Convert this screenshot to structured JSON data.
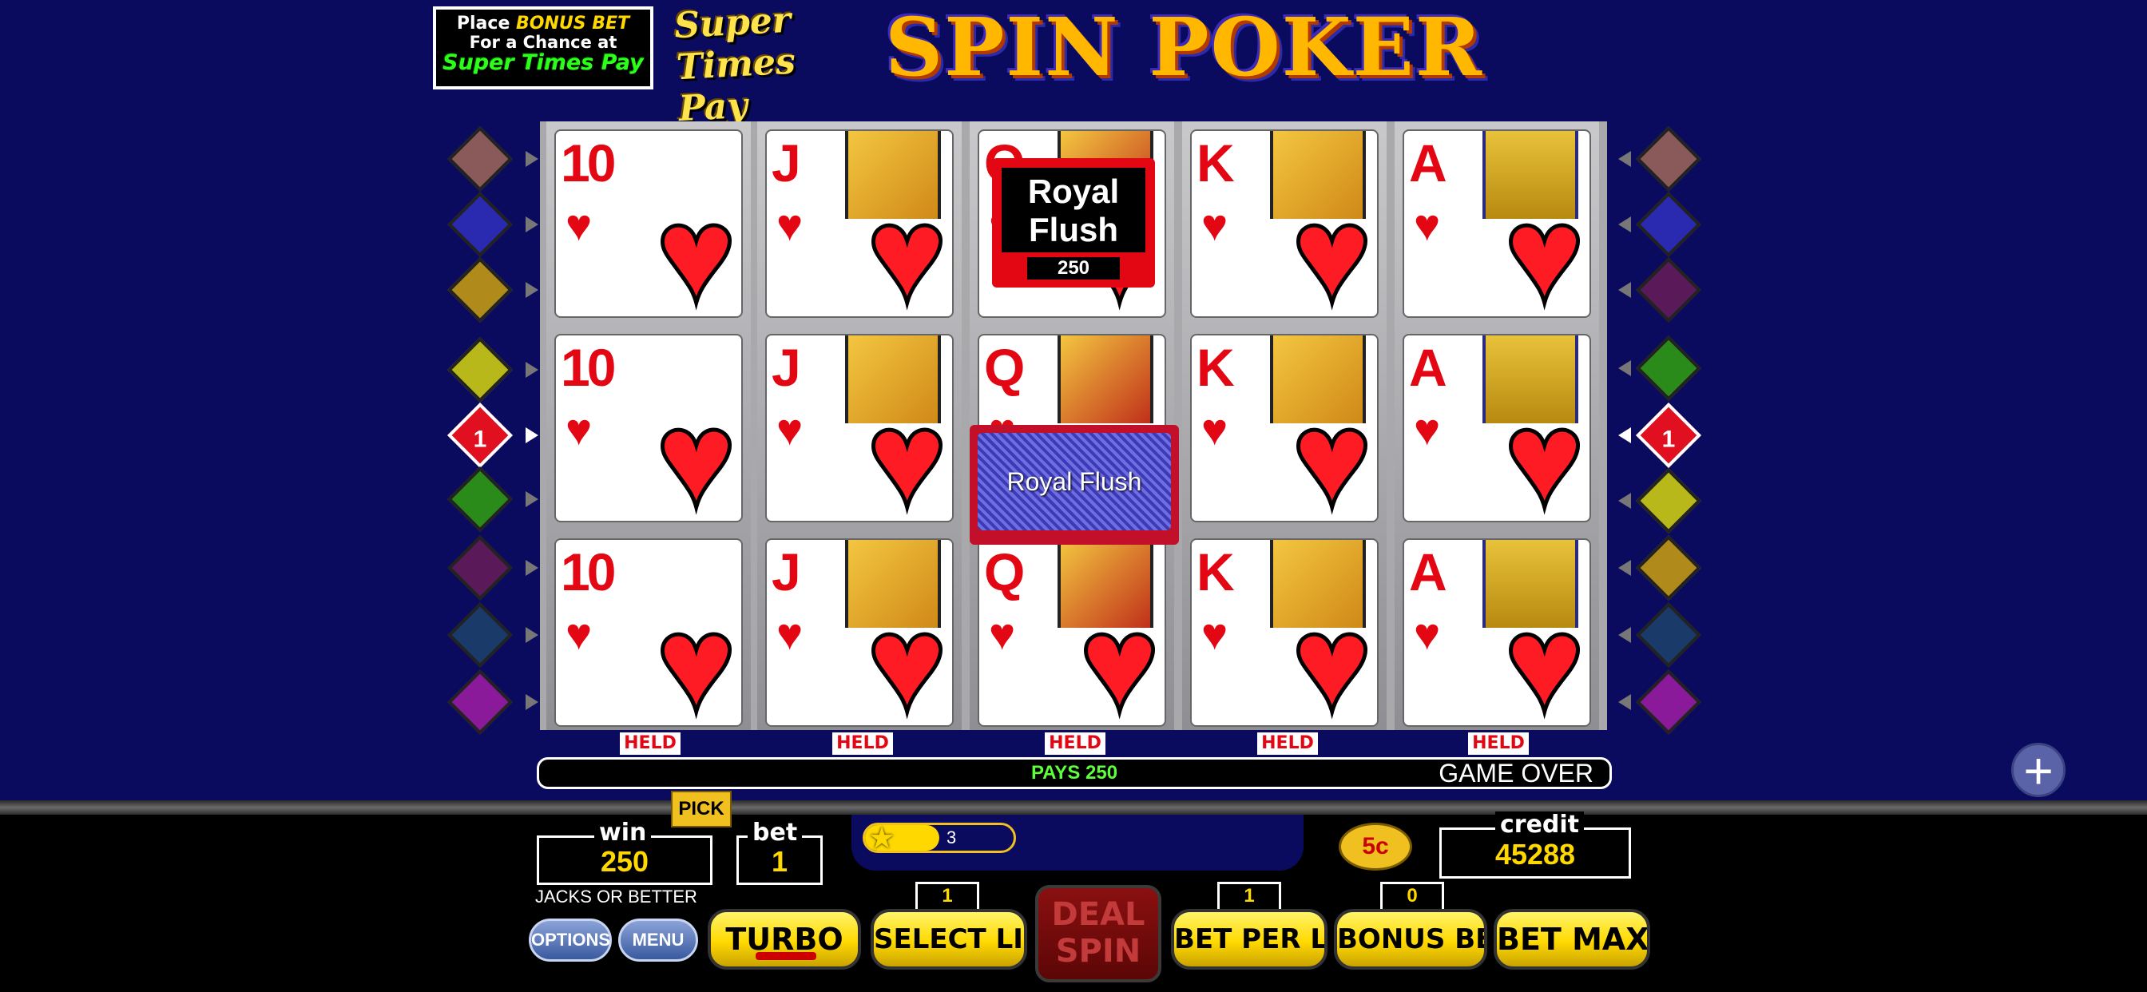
{
  "banner": {
    "promo_line1_a": "Place ",
    "promo_line1_b": "BONUS BET",
    "promo_line2": "For a Chance at",
    "promo_line3": "Super Times Pay",
    "stp_line1": "Super",
    "stp_line2": "Times Pay",
    "title": "SPIN POKER"
  },
  "cards": {
    "col1": {
      "rank": "10",
      "suit": "♥"
    },
    "col2": {
      "rank": "J",
      "suit": "♥"
    },
    "col3": {
      "rank": "Q",
      "suit": "♥"
    },
    "col4": {
      "rank": "K",
      "suit": "♥"
    },
    "col5": {
      "rank": "A",
      "suit": "♥"
    }
  },
  "held_label": "HELD",
  "payline_number": "1",
  "win_overlay": {
    "hand": "Royal Flush",
    "pays": "250"
  },
  "spin_overlay": {
    "hand": "Royal Flush"
  },
  "status": {
    "pays": "PAYS 250",
    "state": "GAME OVER"
  },
  "meters": {
    "pick_label": "PICK",
    "win_label": "win",
    "win_value": "250",
    "bet_label": "bet",
    "bet_value": "1",
    "stars": "3",
    "star_progress": 0.5,
    "denomination": "5c",
    "credit_label": "credit",
    "credit_value": "45288",
    "game_name": "JACKS OR BETTER"
  },
  "buttons": {
    "options": "OPTIONS",
    "menu": "MENU",
    "turbo": "TURBO",
    "select_lines": "SELECT LINES",
    "select_lines_value": "1",
    "deal_line1": "DEAL",
    "deal_line2": "SPIN",
    "bet_per_line": "BET PER LINE",
    "bet_per_line_value": "1",
    "bonus_bet": "BONUS BET",
    "bonus_bet_value": "0",
    "bet_max": "BET MAX",
    "expand_icon": "plus-icon"
  },
  "colors": {
    "background": "#0a0a5e",
    "card_red": "#e30613",
    "button_yellow": "#ffd900",
    "win_green": "#5eff3a"
  },
  "line_indicators": {
    "left": [
      "#8a5a5a",
      "#2a2ab0",
      "#b08a1a",
      "#b8b81a",
      "#e01020",
      "#2a8a1a",
      "#5a1a5a",
      "#1a3a6a",
      "#8a1a9a"
    ],
    "right": [
      "#8a5a5a",
      "#2a2ab0",
      "#5a1a5a",
      "#2a8a1a",
      "#e01020",
      "#b8b81a",
      "#b08a1a",
      "#1a3a6a",
      "#8a1a9a"
    ]
  }
}
